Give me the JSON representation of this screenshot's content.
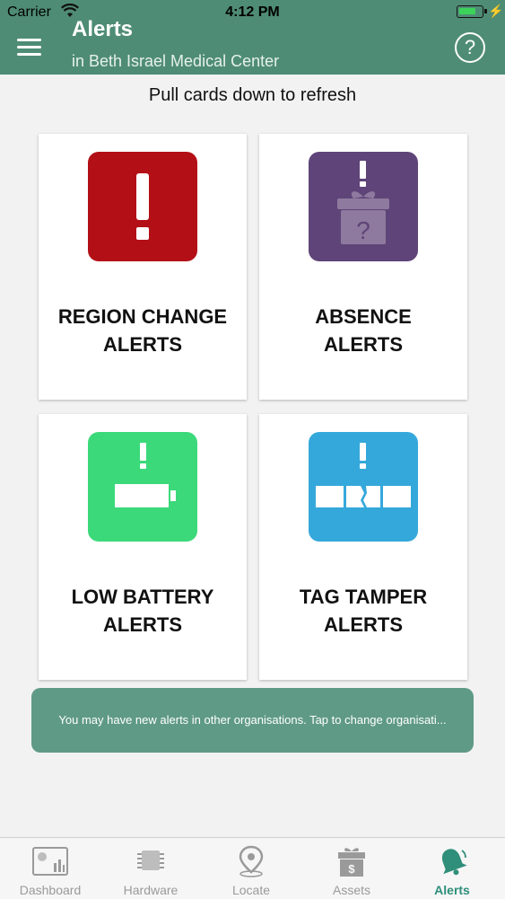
{
  "status": {
    "carrier": "Carrier",
    "time": "4:12 PM"
  },
  "header": {
    "title": "Alerts",
    "subtitle": "in Beth Israel Medical Center",
    "help": "?"
  },
  "refresh_hint": "Pull cards down to refresh",
  "cards": [
    {
      "line1": "REGION CHANGE",
      "line2": "ALERTS",
      "color": "#b30f17",
      "icon": "exclamation-icon"
    },
    {
      "line1": "ABSENCE",
      "line2": "ALERTS",
      "color": "#5e4478",
      "icon": "gift-box-question-icon"
    },
    {
      "line1": "LOW BATTERY",
      "line2": "ALERTS",
      "color": "#3bd97a",
      "icon": "low-battery-icon"
    },
    {
      "line1": "TAG TAMPER",
      "line2": "ALERTS",
      "color": "#35a8db",
      "icon": "broken-tag-icon"
    }
  ],
  "banner": "You may have new alerts in other organisations. Tap to change organisati...",
  "tabs": [
    {
      "label": "Dashboard",
      "icon": "dashboard-icon"
    },
    {
      "label": "Hardware",
      "icon": "chip-icon"
    },
    {
      "label": "Locate",
      "icon": "location-pin-icon"
    },
    {
      "label": "Assets",
      "icon": "asset-gift-icon"
    },
    {
      "label": "Alerts",
      "icon": "bell-icon"
    }
  ],
  "active_tab": "Alerts",
  "colors": {
    "header": "#4f8c76",
    "banner": "#5f9a86",
    "active_tab": "#2f8f7a"
  }
}
